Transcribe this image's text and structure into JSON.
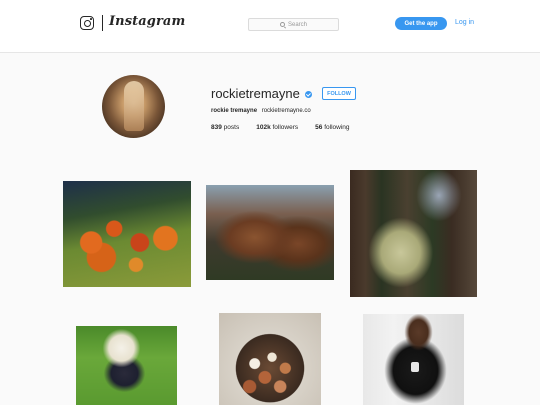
{
  "nav": {
    "wordmark": "Instagram",
    "search_placeholder": "Search",
    "get_app_label": "Get the app",
    "login_label": "Log in"
  },
  "profile": {
    "username": "rockietremayne",
    "follow_label": "FOLLOW",
    "full_name": "rockie tremayne",
    "website": "rockietremayne.co",
    "stats": {
      "posts_count": "839",
      "posts_label": "posts",
      "followers_count": "102k",
      "followers_label": "followers",
      "following_count": "56",
      "following_label": "following"
    }
  },
  "colors": {
    "accent": "#3897f0",
    "text": "#262626",
    "background": "#fafafa"
  },
  "icons": {
    "logo": "instagram-camera-icon",
    "search": "search-icon",
    "verified": "verified-badge-icon"
  },
  "posts": [
    {
      "subject": "pumpkins"
    },
    {
      "subject": "cow"
    },
    {
      "subject": "ferns-and-weathervane"
    },
    {
      "subject": "child-in-sunhat"
    },
    {
      "subject": "eggs-in-basket"
    },
    {
      "subject": "woman-in-black-tshirt"
    }
  ]
}
